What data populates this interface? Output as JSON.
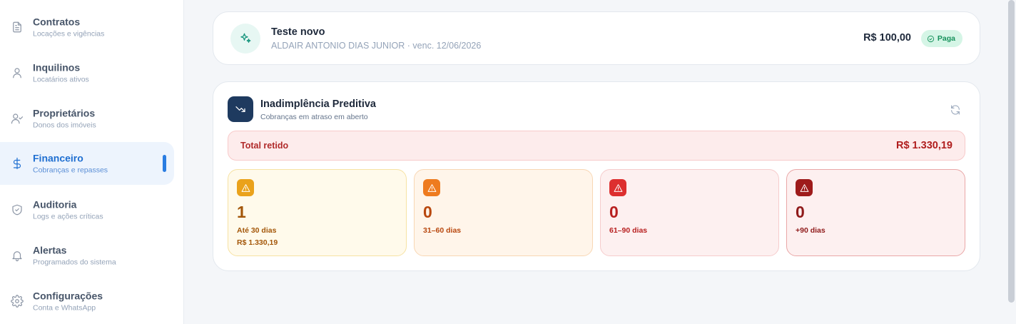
{
  "sidebar": {
    "items": [
      {
        "title": "Contratos",
        "subtitle": "Locações e vigências",
        "icon": "document-icon",
        "active": false
      },
      {
        "title": "Inquilinos",
        "subtitle": "Locatários ativos",
        "icon": "user-icon",
        "active": false
      },
      {
        "title": "Proprietários",
        "subtitle": "Donos dos imóveis",
        "icon": "user-check-icon",
        "active": false
      },
      {
        "title": "Financeiro",
        "subtitle": "Cobranças e repasses",
        "icon": "dollar-icon",
        "active": true
      },
      {
        "title": "Auditoria",
        "subtitle": "Logs e ações críticas",
        "icon": "shield-check-icon",
        "active": false
      },
      {
        "title": "Alertas",
        "subtitle": "Programados do sistema",
        "icon": "bell-icon",
        "active": false
      },
      {
        "title": "Configurações",
        "subtitle": "Conta e WhatsApp",
        "icon": "gear-icon",
        "active": false
      }
    ]
  },
  "payment": {
    "title": "Teste novo",
    "subtitle": "ALDAIR ANTONIO DIAS JUNIOR · venc. 12/06/2026",
    "amount": "R$ 100,00",
    "status": "Paga",
    "icon": "sparkles-icon"
  },
  "inadimplencia": {
    "title": "Inadimplência Preditiva",
    "subtitle": "Cobranças em atraso em aberto",
    "total_label": "Total retido",
    "total_value": "R$ 1.330,19",
    "buckets": [
      {
        "count": "1",
        "label": "Até 30 dias",
        "amount": "R$ 1.330,19"
      },
      {
        "count": "0",
        "label": "31–60 dias",
        "amount": ""
      },
      {
        "count": "0",
        "label": "61–90 dias",
        "amount": ""
      },
      {
        "count": "0",
        "label": "+90 dias",
        "amount": ""
      }
    ]
  },
  "colors": {
    "accent": "#1f6fd1",
    "success": "#16915b",
    "danger": "#b01e1e"
  }
}
